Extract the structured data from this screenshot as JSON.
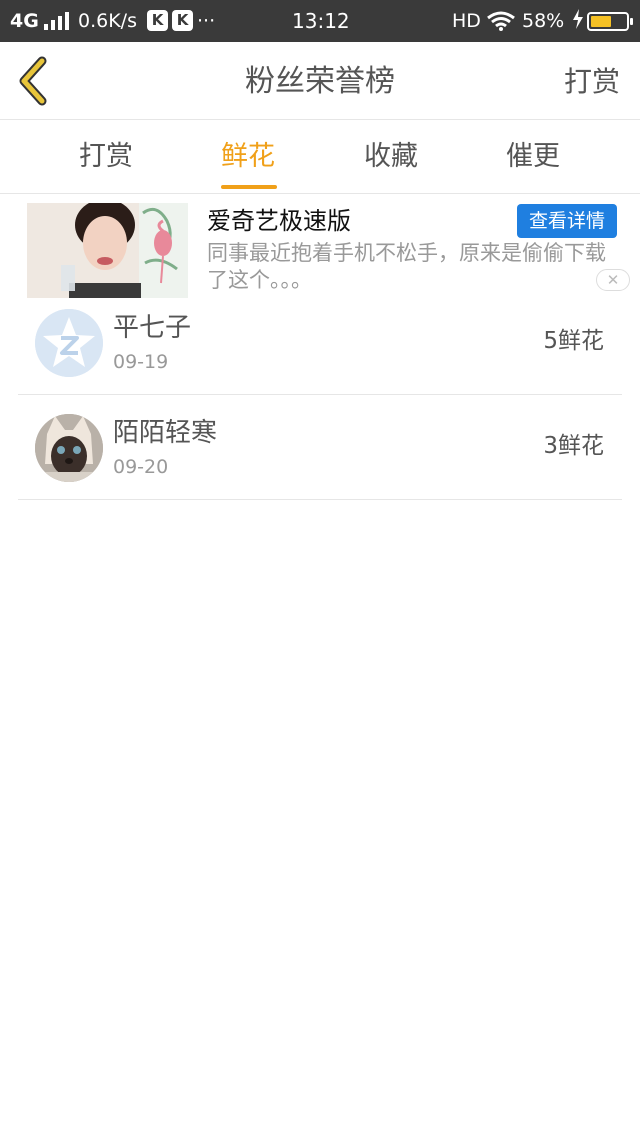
{
  "status_bar": {
    "network": "4G",
    "speed": "0.6K/s",
    "app_badge_1": "K",
    "app_badge_2": "K",
    "more": "···",
    "time": "13:12",
    "hd": "HD",
    "battery_text": "58%",
    "battery_level": 0.58,
    "battery_color": "#f5c125"
  },
  "header": {
    "back_icon": "chevron-left-icon",
    "title": "粉丝荣誉榜",
    "action_label": "打赏",
    "back_color": "#e8c53a"
  },
  "tabs": [
    {
      "label": "打赏"
    },
    {
      "label": "鲜花",
      "active": true
    },
    {
      "label": "收藏"
    },
    {
      "label": "催更"
    }
  ],
  "accent_color": "#f0a019",
  "ad": {
    "title": "爱奇艺极速版",
    "button_label": "查看详情",
    "description": "同事最近抱着手机不松手，原来是偷偷下载了这个。。。",
    "close_label": "✕",
    "button_color": "#1f7fe0"
  },
  "list": [
    {
      "name": "平七子",
      "date": "09-19",
      "count": "5鲜花",
      "avatar": "star-avatar-icon"
    },
    {
      "name": "陌陌轻寒",
      "date": "09-20",
      "count": "3鲜花",
      "avatar": "cat-avatar-icon"
    }
  ]
}
